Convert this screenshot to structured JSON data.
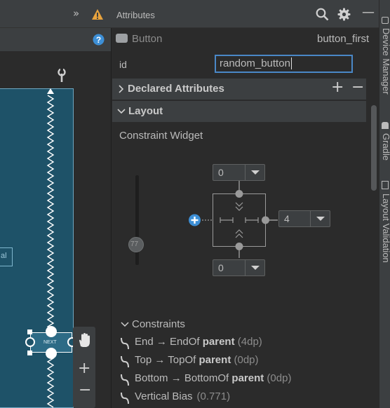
{
  "header": {
    "overflow_glyph": "»",
    "title": "Attributes"
  },
  "component": {
    "type": "Button",
    "name": "button_first"
  },
  "id_field": {
    "label": "id",
    "value": "random_button"
  },
  "sections": {
    "declared": "Declared Attributes",
    "layout": "Layout"
  },
  "constraint_widget": {
    "title": "Constraint Widget",
    "top_margin": "0",
    "bottom_margin": "0",
    "end_margin": "4",
    "vertical_bias": "77"
  },
  "constraints": {
    "title": "Constraints",
    "rows": [
      {
        "a": "End",
        "arrow": "→",
        "b": "EndOf",
        "target": "parent",
        "value": "(4dp)"
      },
      {
        "a": "Top",
        "arrow": "→",
        "b": "TopOf",
        "target": "parent",
        "value": "(0dp)"
      },
      {
        "a": "Bottom",
        "arrow": "→",
        "b": "BottomOf",
        "target": "parent",
        "value": "(0dp)"
      },
      {
        "a": "Vertical Bias",
        "arrow": "",
        "b": "",
        "target": "",
        "value": "(0.771)"
      }
    ]
  },
  "canvas": {
    "button_text": "NEXT",
    "side_label": "al"
  },
  "side_strip": [
    "Device Manager",
    "Gradle",
    "Layout Validation"
  ],
  "colors": {
    "accent_blue": "#4a88c7",
    "warning": "#e8a33d",
    "blueprint": "#1e5268"
  }
}
